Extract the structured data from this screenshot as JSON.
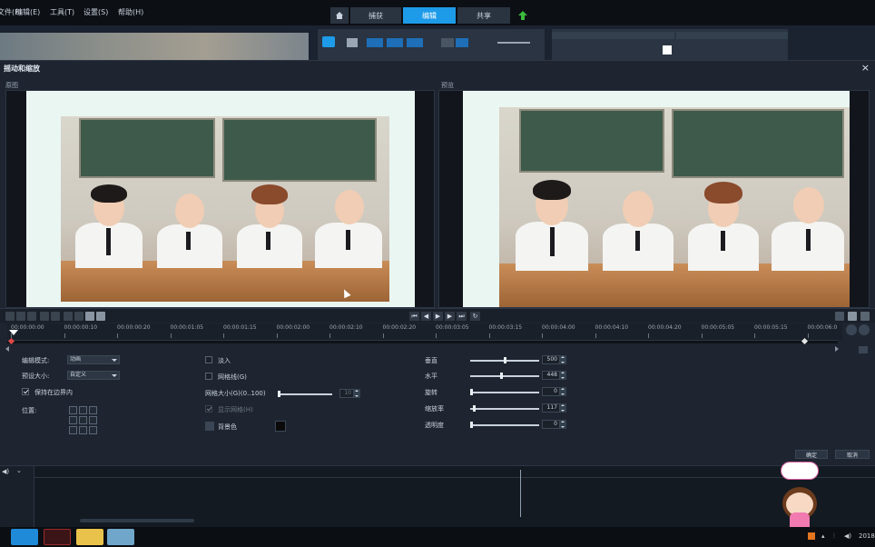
{
  "menubar": {
    "items": [
      "文件(F)",
      "编辑(E)",
      "工具(T)",
      "设置(S)",
      "帮助(H)"
    ],
    "tabs": [
      "捕获",
      "编辑",
      "共享"
    ],
    "active_tab": "编辑"
  },
  "dialog": {
    "title": "摇动和缩放",
    "close": "×",
    "original_label": "原图",
    "preview_label": "预览"
  },
  "timeline": {
    "ticks": [
      "00:00:00:00",
      "00:00:00:10",
      "00:00:00:20",
      "00:00:01:05",
      "00:00:01:15",
      "00:00:02:00",
      "00:00:02:10",
      "00:00:02:20",
      "00:00:03:05",
      "00:00:03:15",
      "00:00:04:00",
      "00:00:04:10",
      "00:00:04:20",
      "00:00:05:05",
      "00:00:05:15",
      "00:00:06:0"
    ]
  },
  "properties": {
    "edit_mode_label": "编辑模式:",
    "edit_mode_value": "动画",
    "preset_size_label": "预设大小:",
    "preset_size_value": "自定义",
    "stay_in_bounds_label": "保持在边界内",
    "stay_in_bounds_checked": true,
    "position_label": "位置:",
    "fade_in_label": "淡入",
    "grid_label": "网格线(G)",
    "grid_size_label": "网格大小(G)(0..100)",
    "grid_size_value": "10",
    "show_grid_label": "显示网格(H)",
    "background_color_label": "背景色",
    "vertical_label": "垂直",
    "vertical_value": "500",
    "horizontal_label": "水平",
    "horizontal_value": "448",
    "rotation_label": "旋转",
    "rotation_value": "0",
    "zoom_label": "缩放率",
    "zoom_value": "117",
    "opacity_label": "透明度",
    "opacity_value": "0",
    "ok_label": "确定",
    "cancel_label": "取消"
  },
  "taskbar": {
    "clock": "2018"
  },
  "colors": {
    "accent": "#1e9be8",
    "background": "#1e2530"
  }
}
